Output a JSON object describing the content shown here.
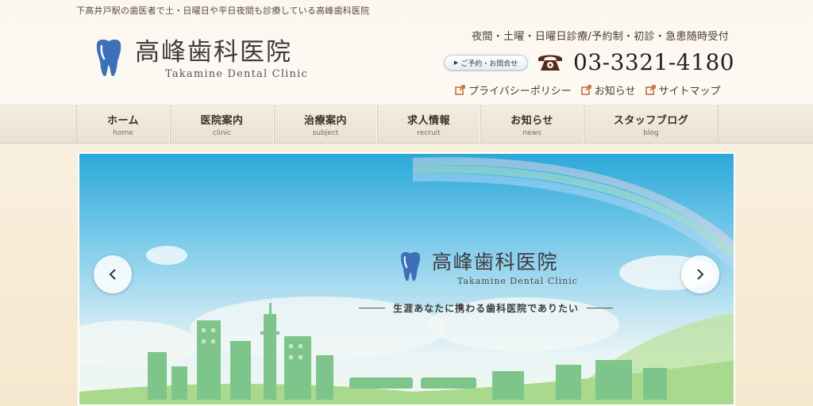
{
  "header": {
    "tagline": "下高井戸駅の歯医者で土・日曜日や平日夜間も診療している高峰歯科医院",
    "logo_jp": "高峰歯科医院",
    "logo_en": "Takamine Dental Clinic",
    "hours": "夜間・土曜・日曜日診療/予約制・初診・急患随時受付",
    "contact_button": "ご予約・お問合せ",
    "phone": "03-3321-4180",
    "links": [
      {
        "label": "プライバシーポリシー"
      },
      {
        "label": "お知らせ"
      },
      {
        "label": "サイトマップ"
      }
    ]
  },
  "nav": {
    "items": [
      {
        "jp": "ホーム",
        "en": "home"
      },
      {
        "jp": "医院案内",
        "en": "clinic"
      },
      {
        "jp": "治療案内",
        "en": "subject"
      },
      {
        "jp": "求人情報",
        "en": "recruit"
      },
      {
        "jp": "お知らせ",
        "en": "news"
      },
      {
        "jp": "スタッフブログ",
        "en": "blog"
      }
    ]
  },
  "slider": {
    "logo_jp": "高峰歯科医院",
    "logo_en": "Takamine Dental Clinic",
    "tagline": "生涯あなたに携わる歯科医院でありたい"
  },
  "colors": {
    "accent_blue": "#3f6fb8",
    "phone_icon": "#5a2a1a",
    "ext_link_icon": "#c0663a"
  },
  "icons": {
    "logo": "tooth-icon",
    "phone": "telephone-icon",
    "links": "external-link-icon",
    "prev": "chevron-left-icon",
    "next": "chevron-right-icon"
  }
}
